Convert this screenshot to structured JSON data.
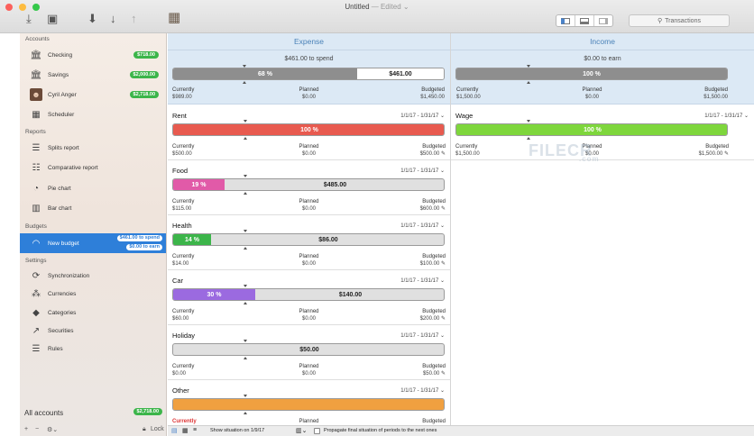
{
  "window": {
    "title": "Untitled",
    "edited": "— Edited"
  },
  "toolbar": {
    "search_placeholder": "Transactions"
  },
  "sidebar": {
    "accounts_header": "Accounts",
    "accounts": [
      {
        "label": "Checking",
        "badge": "$718.00"
      },
      {
        "label": "Savings",
        "badge": "$2,000.00"
      },
      {
        "label": "Cyril Anger",
        "badge": "$2,718.00"
      },
      {
        "label": "Scheduler",
        "badge": ""
      }
    ],
    "reports_header": "Reports",
    "reports": [
      {
        "label": "Splits report"
      },
      {
        "label": "Comparative report"
      },
      {
        "label": "Pie chart"
      },
      {
        "label": "Bar chart"
      }
    ],
    "budgets_header": "Budgets",
    "budget": {
      "label": "New budget",
      "badge1": "$461.00 to spend",
      "badge2": "$0.00 to earn"
    },
    "settings_header": "Settings",
    "settings": [
      {
        "label": "Synchronization"
      },
      {
        "label": "Currencies"
      },
      {
        "label": "Categories"
      },
      {
        "label": "Securities"
      },
      {
        "label": "Rules"
      }
    ],
    "all_accounts": "All accounts",
    "all_badge": "$2,718.00",
    "lock": "Lock"
  },
  "expense": {
    "header": "Expense",
    "summary": "$461.00 to spend",
    "bar": {
      "pct_label": "68 %",
      "pct": 68,
      "rest": "$461.00",
      "color": "#8e8e8e"
    },
    "labels": {
      "currently": "Currently",
      "planned": "Planned",
      "budgeted": "Budgeted"
    },
    "values": {
      "currently": "$989.00",
      "planned": "$0.00",
      "budgeted": "$1,450.00"
    },
    "categories": [
      {
        "name": "Rent",
        "dates": "1/1/17 - 1/31/17",
        "pct_label": "100 %",
        "pct": 100,
        "rest": "",
        "color": "#e85a4f",
        "currently": "$500.00",
        "planned": "$0.00",
        "budgeted": "$500.00",
        "current_label": "Currently"
      },
      {
        "name": "Food",
        "dates": "1/1/17 - 1/31/17",
        "pct_label": "19 %",
        "pct": 19,
        "rest": "$485.00",
        "color": "#e15aa8",
        "currently": "$115.00",
        "planned": "$0.00",
        "budgeted": "$600.00",
        "current_label": "Currently"
      },
      {
        "name": "Health",
        "dates": "1/1/17 - 1/31/17",
        "pct_label": "14 %",
        "pct": 14,
        "rest": "$86.00",
        "color": "#3cb54a",
        "currently": "$14.00",
        "planned": "$0.00",
        "budgeted": "$100.00",
        "current_label": "Currently"
      },
      {
        "name": "Car",
        "dates": "1/1/17 - 1/31/17",
        "pct_label": "30 %",
        "pct": 30,
        "rest": "$140.00",
        "color": "#9b6ae0",
        "currently": "$60.00",
        "planned": "$0.00",
        "budgeted": "$200.00",
        "current_label": "Currently"
      },
      {
        "name": "Holiday",
        "dates": "1/1/17 - 1/31/17",
        "pct_label": "",
        "pct": 0,
        "rest": "$50.00",
        "color": "#bbbbbb",
        "currently": "$0.00",
        "planned": "$0.00",
        "budgeted": "$50.00",
        "current_label": "Currently"
      },
      {
        "name": "Other",
        "dates": "1/1/17 - 1/31/17",
        "pct_label": "",
        "pct": 100,
        "rest": "",
        "color": "#f0a040",
        "currently": "",
        "planned": "",
        "budgeted": "",
        "current_label": "Currently"
      }
    ]
  },
  "income": {
    "header": "Income",
    "summary": "$0.00 to earn",
    "bar": {
      "pct_label": "100 %",
      "pct": 100,
      "rest": "",
      "color": "#8e8e8e"
    },
    "values": {
      "currently": "$1,500.00",
      "planned": "$0.00",
      "budgeted": "$1,500.00"
    },
    "categories": [
      {
        "name": "Wage",
        "dates": "1/1/17 - 1/31/17",
        "pct_label": "100 %",
        "pct": 100,
        "rest": "",
        "color": "#7ed63c",
        "currently": "$1,500.00",
        "planned": "$0.00",
        "budgeted": "$1,500.00"
      }
    ]
  },
  "statusbar": {
    "show_situation": "Show situation on 1/9/17",
    "propagate": "Propagate final situation of periods to the next ones"
  },
  "watermark": {
    "main": "FILECR",
    "sub": ".com"
  }
}
